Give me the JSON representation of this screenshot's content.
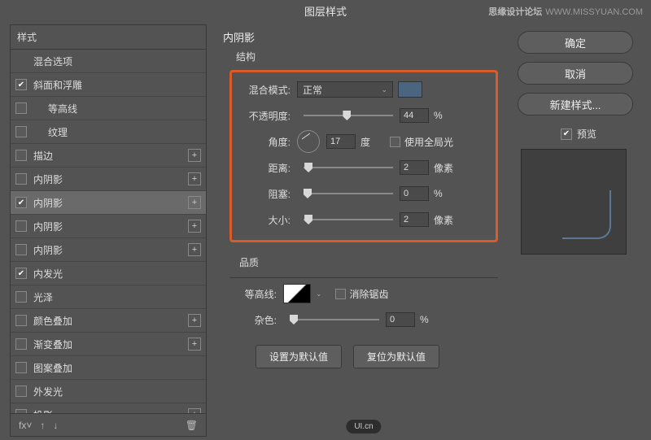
{
  "title": "图层样式",
  "watermark": {
    "cn": "思缘设计论坛",
    "en": "WWW.MISSYUAN.COM"
  },
  "sidebar": {
    "header": "样式",
    "items": [
      {
        "label": "混合选项",
        "checked": null,
        "plus": false,
        "selected": false,
        "indent": false
      },
      {
        "label": "斜面和浮雕",
        "checked": true,
        "plus": false,
        "selected": false,
        "indent": false
      },
      {
        "label": "等高线",
        "checked": false,
        "plus": false,
        "selected": false,
        "indent": true
      },
      {
        "label": "纹理",
        "checked": false,
        "plus": false,
        "selected": false,
        "indent": true
      },
      {
        "label": "描边",
        "checked": false,
        "plus": true,
        "selected": false,
        "indent": false
      },
      {
        "label": "内阴影",
        "checked": false,
        "plus": true,
        "selected": false,
        "indent": false
      },
      {
        "label": "内阴影",
        "checked": true,
        "plus": true,
        "selected": true,
        "indent": false
      },
      {
        "label": "内阴影",
        "checked": false,
        "plus": true,
        "selected": false,
        "indent": false
      },
      {
        "label": "内阴影",
        "checked": false,
        "plus": true,
        "selected": false,
        "indent": false
      },
      {
        "label": "内发光",
        "checked": true,
        "plus": false,
        "selected": false,
        "indent": false
      },
      {
        "label": "光泽",
        "checked": false,
        "plus": false,
        "selected": false,
        "indent": false
      },
      {
        "label": "颜色叠加",
        "checked": false,
        "plus": true,
        "selected": false,
        "indent": false
      },
      {
        "label": "渐变叠加",
        "checked": false,
        "plus": true,
        "selected": false,
        "indent": false
      },
      {
        "label": "图案叠加",
        "checked": false,
        "plus": false,
        "selected": false,
        "indent": false
      },
      {
        "label": "外发光",
        "checked": false,
        "plus": false,
        "selected": false,
        "indent": false
      },
      {
        "label": "投影",
        "checked": false,
        "plus": true,
        "selected": false,
        "indent": false
      }
    ]
  },
  "panel": {
    "title": "内阴影",
    "structure_label": "结构",
    "blend_mode_label": "混合模式:",
    "blend_mode_value": "正常",
    "opacity_label": "不透明度:",
    "opacity_value": "44",
    "opacity_unit": "%",
    "angle_label": "角度:",
    "angle_value": "17",
    "angle_unit": "度",
    "global_light_label": "使用全局光",
    "distance_label": "距离:",
    "distance_value": "2",
    "distance_unit": "像素",
    "choke_label": "阻塞:",
    "choke_value": "0",
    "choke_unit": "%",
    "size_label": "大小:",
    "size_value": "2",
    "size_unit": "像素",
    "quality_label": "品质",
    "contour_label": "等高线:",
    "antialias_label": "消除锯齿",
    "noise_label": "杂色:",
    "noise_value": "0",
    "noise_unit": "%",
    "set_default": "设置为默认值",
    "reset_default": "复位为默认值",
    "swatch_color": "#4a6580"
  },
  "right": {
    "ok": "确定",
    "cancel": "取消",
    "new_style": "新建样式...",
    "preview": "预览"
  },
  "bottom_watermark": "UI.cn"
}
